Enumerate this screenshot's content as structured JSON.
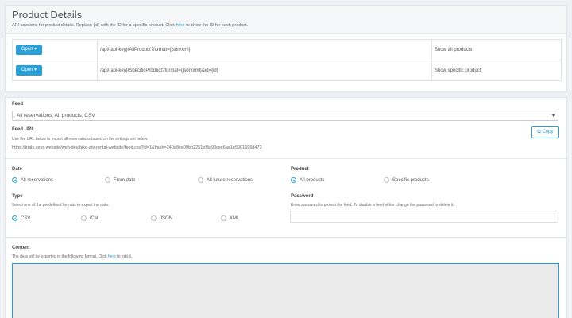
{
  "product": {
    "title": "Product Details",
    "desc_pre": "API functions for product details. Replace {id} with the ID for a specific product. Click ",
    "desc_link": "here",
    "desc_post": " to show the ID for each product.",
    "rows": [
      {
        "btn": "Open ▾",
        "path": "/api/{api-key}/AllProduct?format={json/xml}",
        "desc": "Show all products"
      },
      {
        "btn": "Open ▾",
        "path": "/api/{api-key}/SpecificProduct?format={json/xml}&id={id}",
        "desc": "Show specific product"
      }
    ]
  },
  "feed": {
    "label": "Feed",
    "select_value": "All reservations; All products; CSV",
    "url_label": "Feed URL",
    "url_help": "Use the URL below to import all reservations based on the settings set below.",
    "url": "https://trials.vevs.website/web-dev/bike-atv-rental-website/feed.csv?id=1&hash=240a8ce09bb2251ef3a90cec6aa1e5001696d473",
    "copy_label": "Copy",
    "copy_icon": "copy-icon"
  },
  "date": {
    "label": "Date",
    "options": [
      "All reservations",
      "From date",
      "All future reservations"
    ],
    "selected": 0
  },
  "product_filter": {
    "label": "Product",
    "options": [
      "All products",
      "Specific products"
    ],
    "selected": 0
  },
  "type": {
    "label": "Type",
    "help": "Select one of the predefined formats to export the data.",
    "options": [
      "CSV",
      "iCal",
      "JSON",
      "XML"
    ],
    "selected": 0
  },
  "password": {
    "label": "Password",
    "help": "Enter password to protect the feed. To disable a feed either change the password or delete it."
  },
  "content": {
    "label": "Content",
    "help_pre": "The data will be exported in the following format. Click ",
    "help_link": "here",
    "help_post": " to edit it."
  },
  "colors": {
    "accent": "#2a9fd6"
  }
}
